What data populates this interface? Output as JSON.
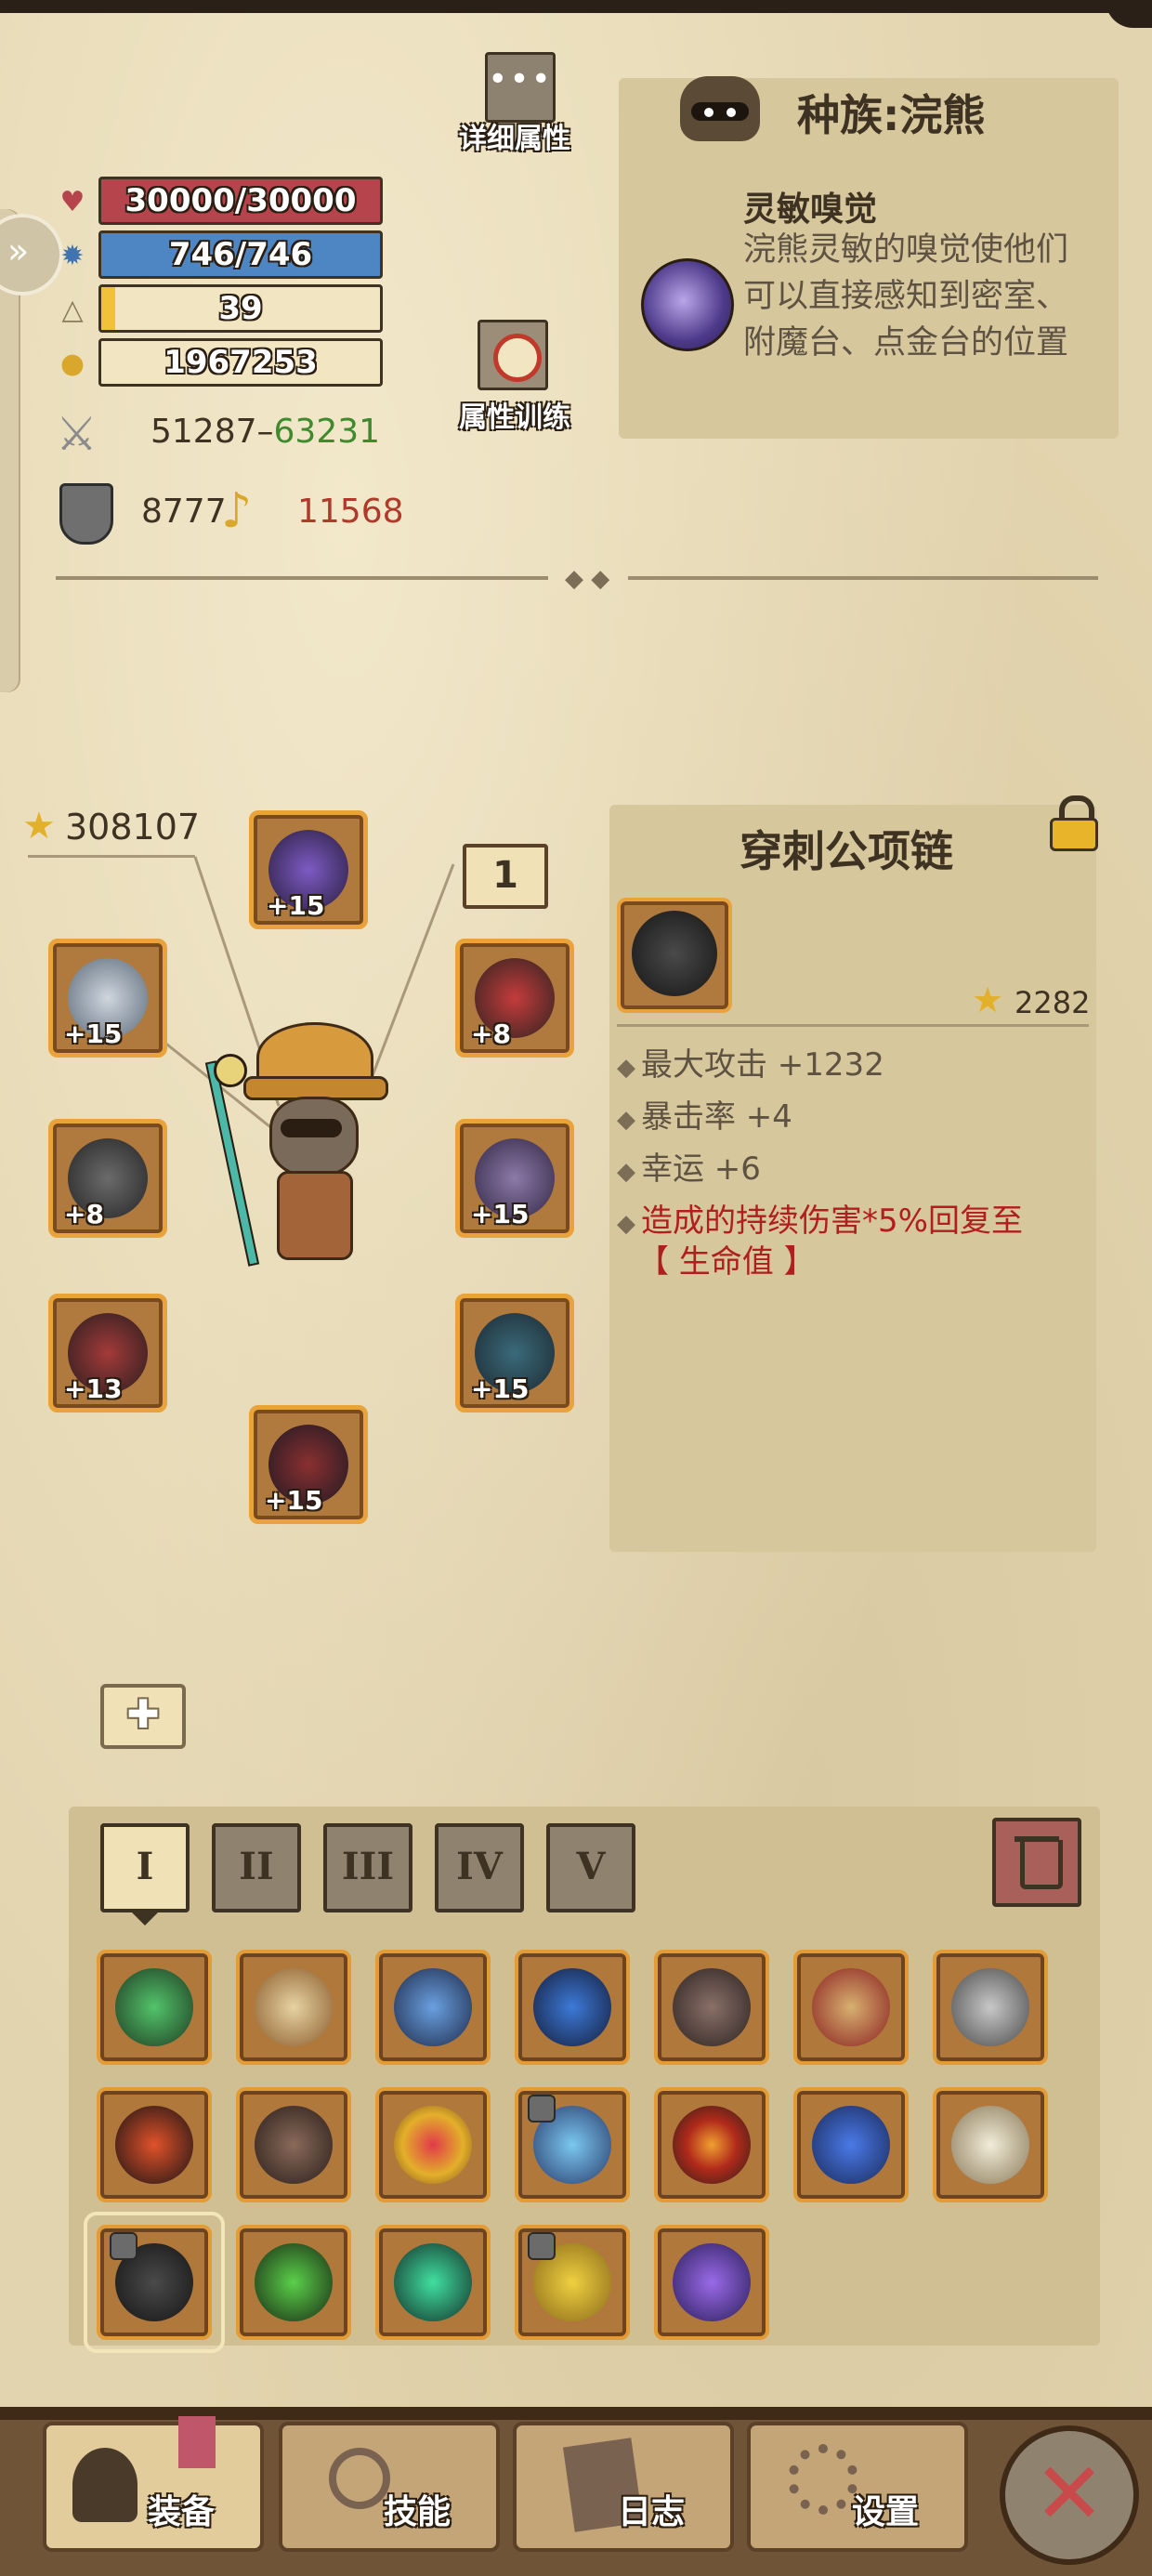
{
  "header": {
    "detail_attr_label": "详细属性",
    "train_attr_label": "属性训练"
  },
  "stats": {
    "hp": "30000/30000",
    "mp": "746/746",
    "level": "39",
    "gold": "1967253",
    "attack_min": "51287",
    "attack_sep": "–",
    "attack_max": "63231",
    "defense": "8777",
    "other": "11568"
  },
  "race_panel": {
    "title": "种族:浣熊",
    "skill_name": "灵敏嗅觉",
    "skill_desc": "浣熊灵敏的嗅觉使他们可以直接感知到密室、附魔台、点金台的位置"
  },
  "equip": {
    "score": "308107",
    "page_badge": "1",
    "slots": {
      "helm": "+15",
      "necklace": "+8",
      "shield": "+15",
      "armor": "+15",
      "boots": "+15",
      "ring": "+15",
      "weapon": "+8",
      "gloves": "+13"
    }
  },
  "item_panel": {
    "title": "穿刺公项链",
    "score": "2282",
    "lines": [
      "最大攻击 +1232",
      "暴击率 +4",
      "幸运 +6"
    ],
    "special_line1": "造成的持续伤害*5%回复至",
    "special_line2": "【 生命值 】"
  },
  "bag_tabs": [
    "I",
    "II",
    "III",
    "IV",
    "V"
  ],
  "dock": {
    "equip": "装备",
    "skill": "技能",
    "log": "日志",
    "settings": "设置"
  },
  "colors": {
    "hp_fill": "#b5444c",
    "mp_fill": "#4e86c4",
    "xp_fill": "#f0c23a",
    "attack_max": "#3e8a2c",
    "other_value": "#b03a2a",
    "special_text": "#b01e1e"
  },
  "icons": {
    "hp": "heart-icon",
    "mp": "gear-icon",
    "level": "triangle-icon",
    "gold": "gold-pile-icon",
    "attack": "crossed-swords-icon",
    "defense": "shield-icon",
    "other": "horn-icon"
  },
  "xp_progress": 0.05
}
